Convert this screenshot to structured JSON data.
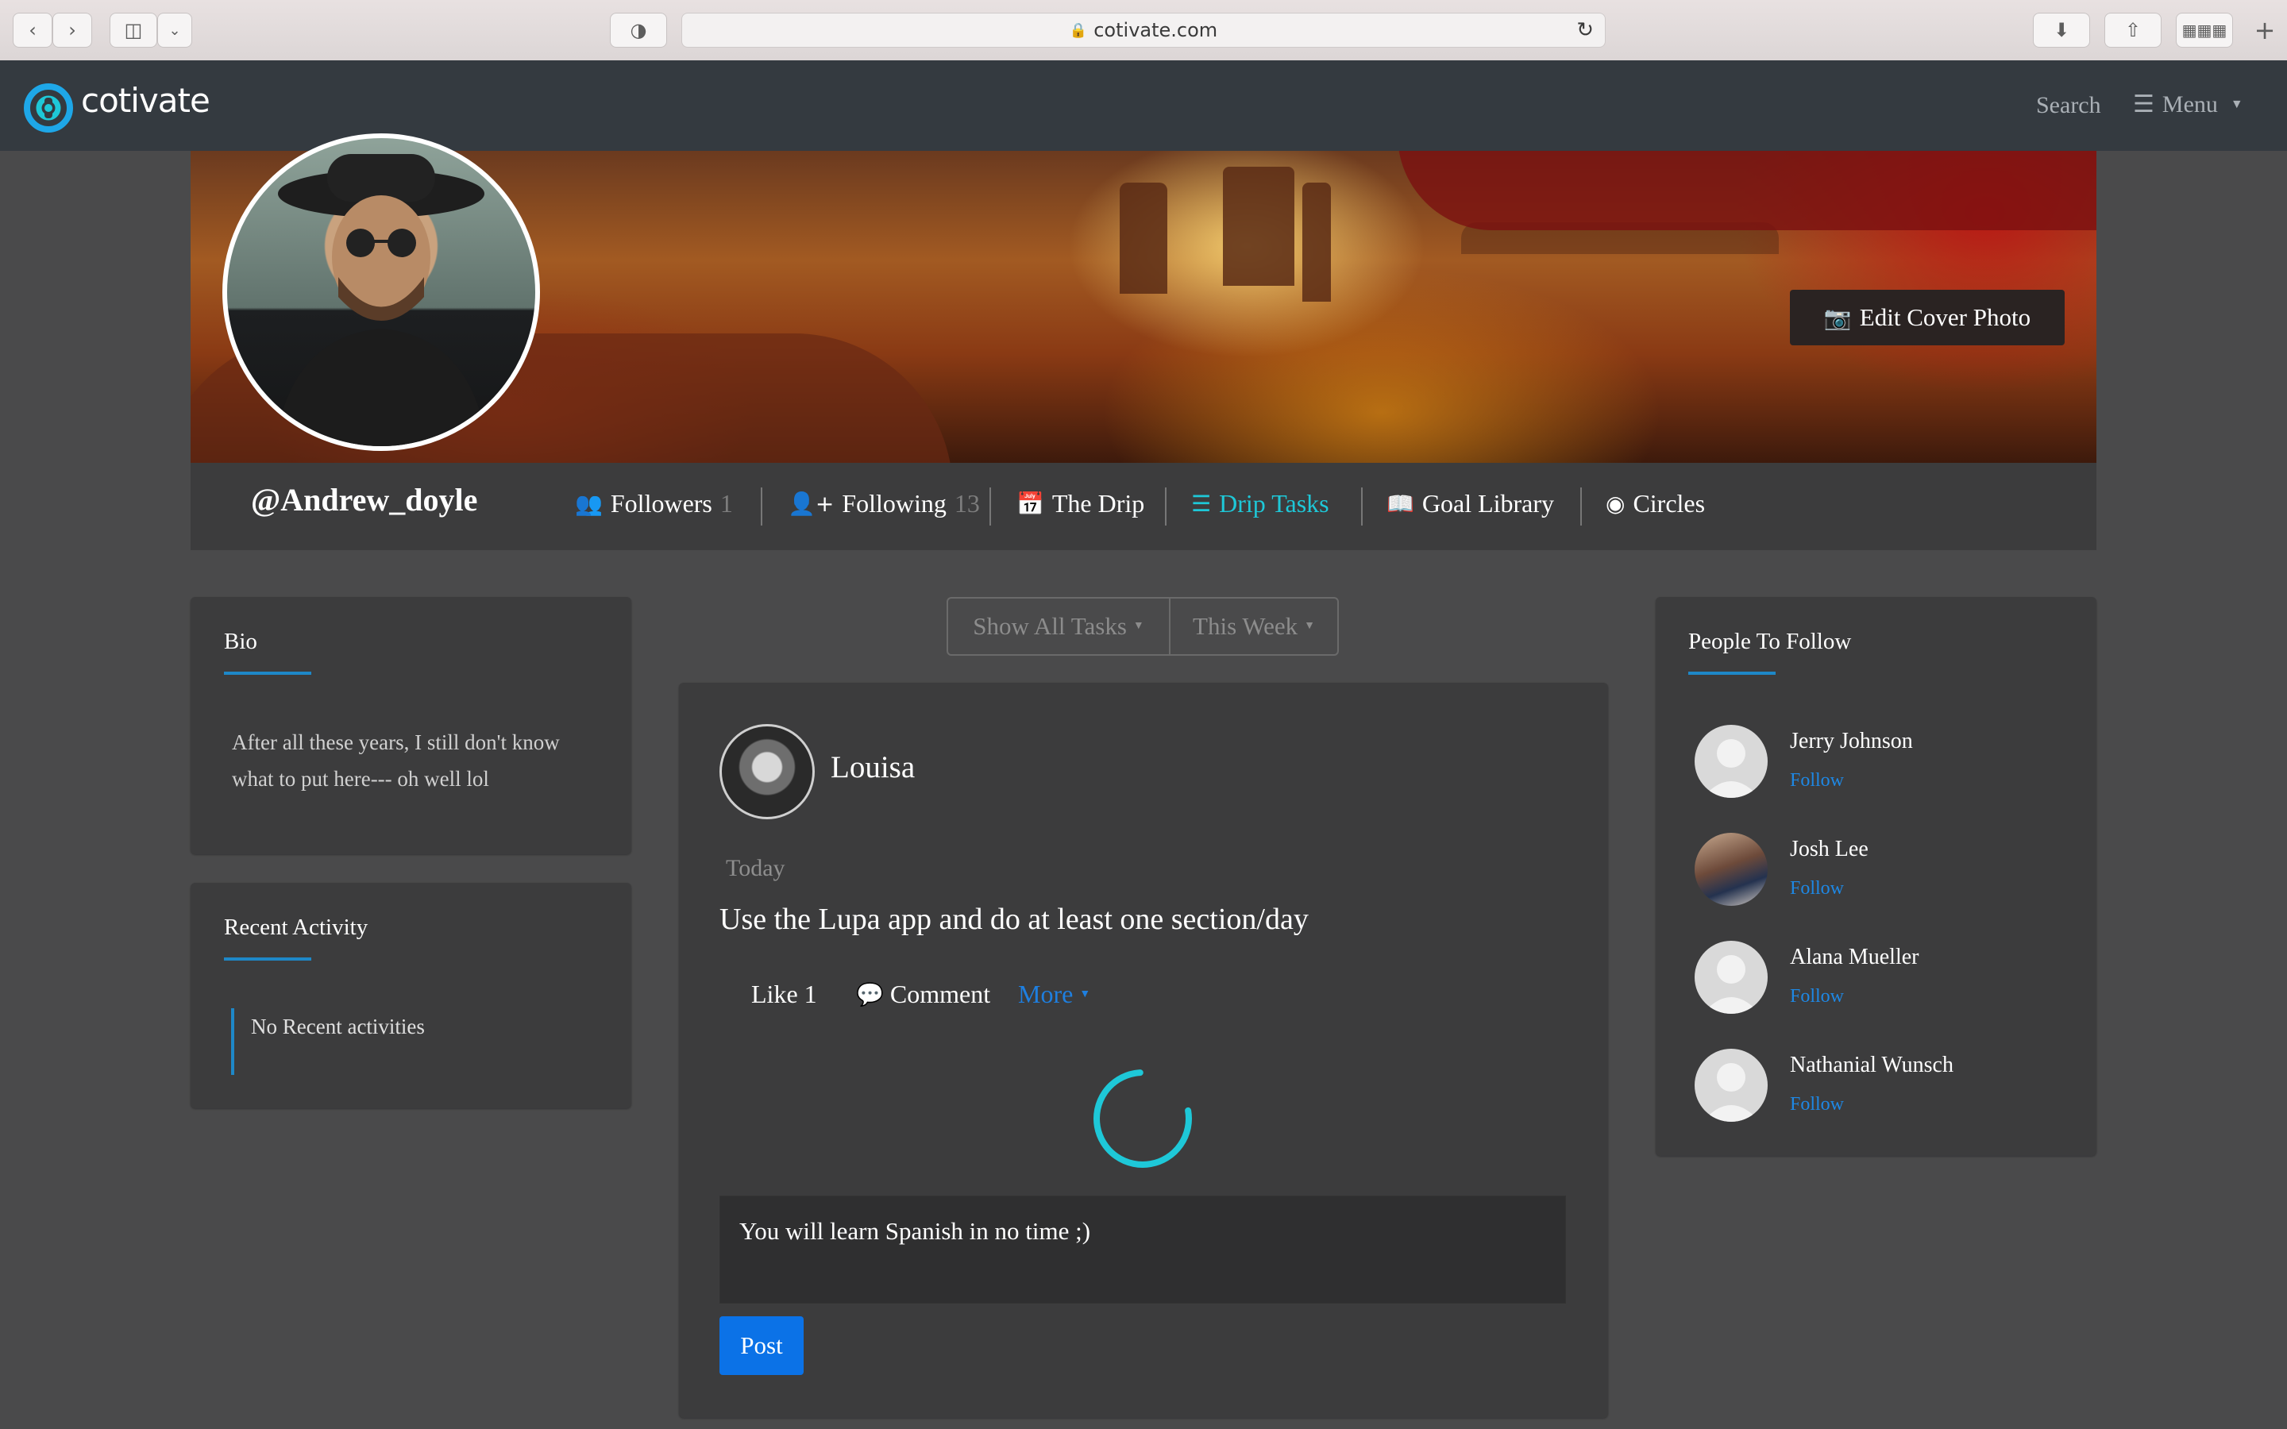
{
  "browser": {
    "url": "cotivate.com"
  },
  "header": {
    "logo_text": "cotivate",
    "search_label": "Search",
    "menu_label": "Menu"
  },
  "profile": {
    "username": "@Andrew_doyle",
    "edit_cover_label": "Edit Cover Photo",
    "nav": {
      "followers_label": "Followers",
      "followers_count": "1",
      "following_label": "Following",
      "following_count": "13",
      "drip_label": "The Drip",
      "drip_tasks_label": "Drip Tasks",
      "goal_library_label": "Goal Library",
      "circles_label": "Circles"
    },
    "active_tab": "Drip Tasks"
  },
  "bio": {
    "title": "Bio",
    "text": "After all these years, I still don't know what to put here--- oh well lol"
  },
  "recent_activity": {
    "title": "Recent Activity",
    "empty_text": "No Recent activities"
  },
  "filters": {
    "task_filter": "Show All Tasks",
    "period_filter": "This Week"
  },
  "post": {
    "author": "Louisa",
    "date": "Today",
    "text": "Use the Lupa app and do at least one section/day",
    "like_label": "Like",
    "like_count": "1",
    "comment_label": "Comment",
    "more_label": "More",
    "comment_value": "You will learn Spanish in no time ;)",
    "post_button": "Post"
  },
  "people_to_follow": {
    "title": "People To Follow",
    "people": [
      {
        "name": "Jerry Johnson",
        "action": "Follow"
      },
      {
        "name": "Josh Lee",
        "action": "Follow"
      },
      {
        "name": "Alana Mueller",
        "action": "Follow"
      },
      {
        "name": "Nathanial Wunsch",
        "action": "Follow"
      }
    ]
  },
  "colors": {
    "accent": "#1ec8d8",
    "link": "#1e88e5",
    "primary_button": "#0b72e7",
    "header_bg": "#343a40",
    "page_bg": "#4a4a4b",
    "card_bg": "#3c3c3d"
  }
}
